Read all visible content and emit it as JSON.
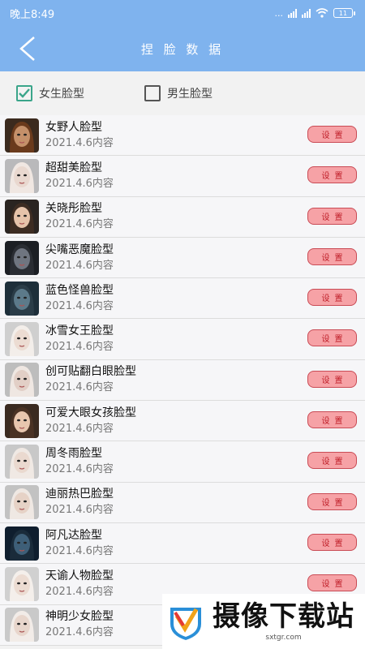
{
  "status": {
    "time": "晚上8:49",
    "speed": "...",
    "battery": "11"
  },
  "header": {
    "title": "捏 脸 数 据"
  },
  "filter": {
    "female_label": "女生脸型",
    "male_label": "男生脸型",
    "female_checked": true,
    "male_checked": false
  },
  "items": [
    {
      "name": "女野人脸型",
      "date": "2021.4.6内容",
      "button": "设置"
    },
    {
      "name": "超甜美脸型",
      "date": "2021.4.6内容",
      "button": "设置"
    },
    {
      "name": "关晓彤脸型",
      "date": "2021.4.6内容",
      "button": "设置"
    },
    {
      "name": "尖嘴恶魔脸型",
      "date": "2021.4.6内容",
      "button": "设置"
    },
    {
      "name": "蓝色怪兽脸型",
      "date": "2021.4.6内容",
      "button": "设置"
    },
    {
      "name": "冰雪女王脸型",
      "date": "2021.4.6内容",
      "button": "设置"
    },
    {
      "name": "创可贴翻白眼脸型",
      "date": "2021.4.6内容",
      "button": "设置"
    },
    {
      "name": "可爱大眼女孩脸型",
      "date": "2021.4.6内容",
      "button": "设置"
    },
    {
      "name": "周冬雨脸型",
      "date": "2021.4.6内容",
      "button": "设置"
    },
    {
      "name": "迪丽热巴脸型",
      "date": "2021.4.6内容",
      "button": "设置"
    },
    {
      "name": "阿凡达脸型",
      "date": "2021.4.6内容",
      "button": "设置"
    },
    {
      "name": "天谕人物脸型",
      "date": "2021.4.6内容",
      "button": "设置"
    },
    {
      "name": "神明少女脸型",
      "date": "2021.4.6内容",
      "button": "设置"
    }
  ],
  "watermark": {
    "title": "摄像下载站",
    "url": "sxtgr.com"
  },
  "colors": {
    "header": "#7fb3ee",
    "button_bg": "#f6a2a6",
    "button_border": "#c94b55",
    "check": "#3aa58a"
  }
}
